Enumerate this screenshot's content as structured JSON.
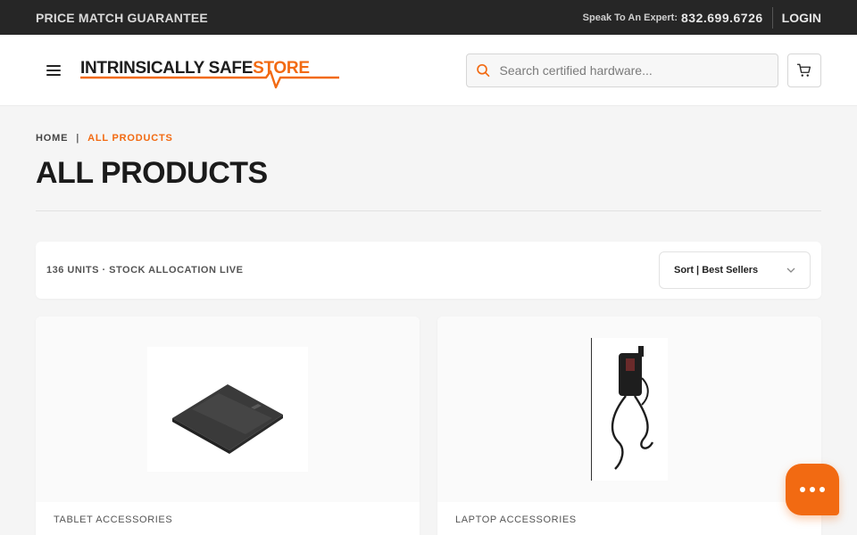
{
  "topbar": {
    "promo": "PRICE MATCH GUARANTEE",
    "expert_label": "Speak To An Expert:",
    "phone": "832.699.6726",
    "login": "LOGIN"
  },
  "header": {
    "logo_part1": "INTRINSICALLY SAFE",
    "logo_part2": "STORE",
    "search_placeholder": "Search certified hardware...",
    "search_value": ""
  },
  "breadcrumb": {
    "home": "HOME",
    "separator": "|",
    "current": "ALL PRODUCTS"
  },
  "page": {
    "title": "ALL PRODUCTS"
  },
  "toolbar": {
    "count_text": "136 UNITS · STOCK ALLOCATION LIVE",
    "sort_label": "Sort | Best Sellers"
  },
  "products": [
    {
      "category": "TABLET ACCESSORIES",
      "image": "battery-pack"
    },
    {
      "category": "LAPTOP ACCESSORIES",
      "image": "vehicle-power-adapter"
    }
  ],
  "colors": {
    "accent": "#f26a12",
    "topbar": "#262626",
    "background": "#f5f5f5"
  },
  "icons": {
    "menu": "hamburger-icon",
    "search": "search-icon",
    "cart": "cart-icon",
    "sort": "chevron-down-icon",
    "chat": "chat-icon"
  }
}
